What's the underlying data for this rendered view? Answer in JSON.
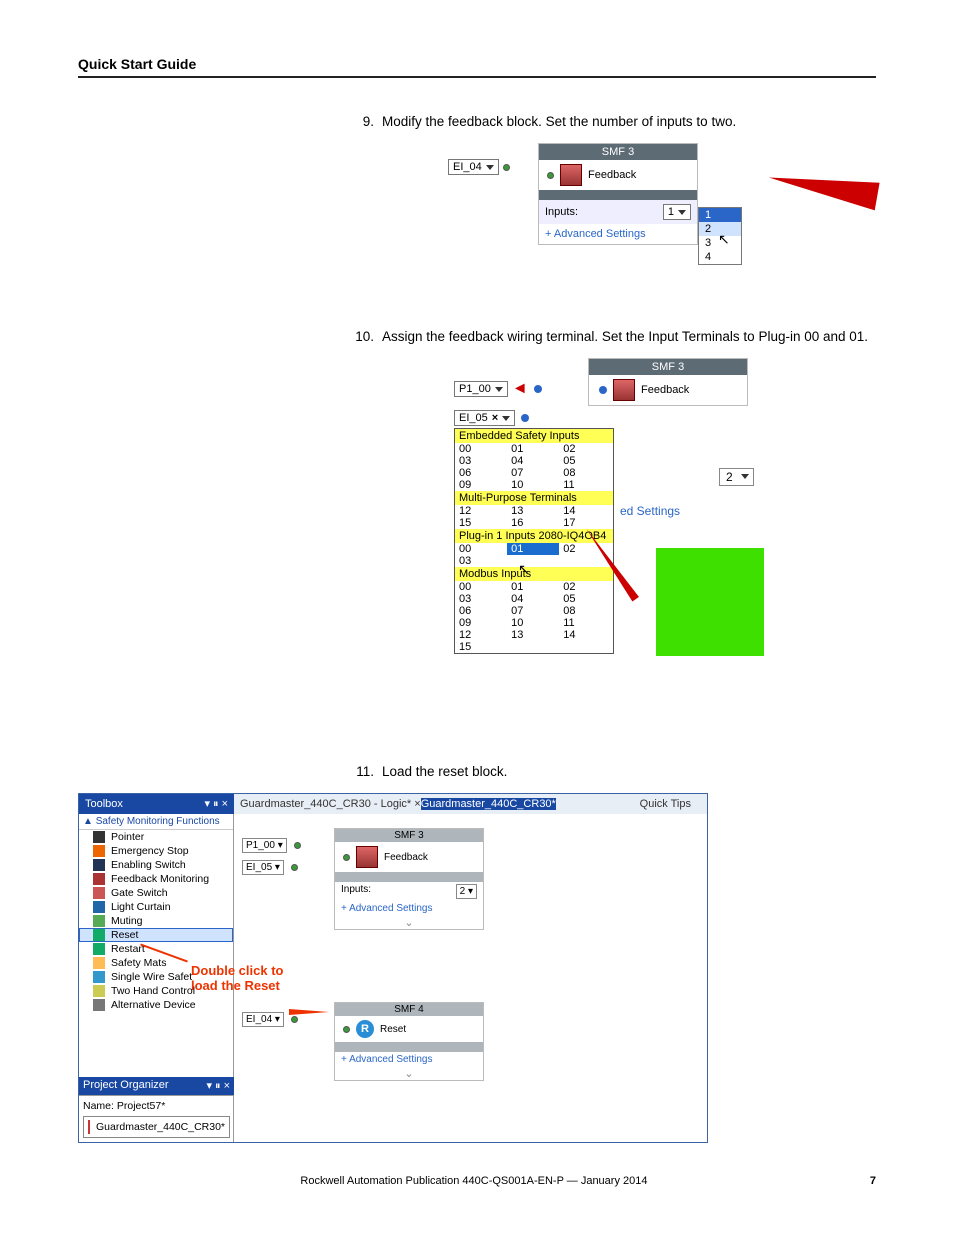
{
  "header": {
    "title": "Quick Start Guide"
  },
  "steps": [
    {
      "num": "9.",
      "text": "Modify the feedback block. Set the number of inputs to two."
    },
    {
      "num": "10.",
      "text": "Assign the feedback wiring terminal. Set the Input Terminals to Plug-in 00 and 01."
    },
    {
      "num": "11.",
      "text": "Load the reset block."
    }
  ],
  "fig1": {
    "selector": "EI_04",
    "card_title": "SMF 3",
    "card_label": "Feedback",
    "inputs_label": "Inputs:",
    "inputs_value": "1",
    "adv": "+ Advanced Settings",
    "dropdown": [
      "1",
      "2",
      "3",
      "4"
    ]
  },
  "fig2": {
    "card_title": "SMF 3",
    "card_label": "Feedback",
    "sel_top": "P1_00",
    "sel_bot": "EI_05",
    "menu": {
      "h1": "Embedded Safety Inputs",
      "rows1": [
        [
          "00",
          "01",
          "02"
        ],
        [
          "03",
          "04",
          "05"
        ],
        [
          "06",
          "07",
          "08"
        ],
        [
          "09",
          "10",
          "11"
        ]
      ],
      "h2": "Multi-Purpose Terminals",
      "rows2": [
        [
          "12",
          "13",
          "14"
        ],
        [
          "15",
          "16",
          "17"
        ]
      ],
      "h3": "Plug-in 1 Inputs 2080-IQ4OB4",
      "rows3": [
        [
          "00",
          "01",
          "02"
        ],
        [
          "03",
          "",
          ""
        ]
      ],
      "h4": "Modbus Inputs",
      "rows4": [
        [
          "00",
          "01",
          "02"
        ],
        [
          "03",
          "04",
          "05"
        ],
        [
          "06",
          "07",
          "08"
        ],
        [
          "09",
          "10",
          "11"
        ],
        [
          "12",
          "13",
          "14"
        ],
        [
          "15",
          "",
          ""
        ]
      ]
    },
    "right_label": "ed Settings",
    "num_box": "2"
  },
  "fig3": {
    "toolbox_title": "Toolbox",
    "toolbox_pins": "▾ ⏸ ×",
    "toolbox_subtitle": "Safety Monitoring Functions",
    "items": [
      {
        "label": "Pointer",
        "ic": "#333"
      },
      {
        "label": "Emergency Stop",
        "ic": "#e60"
      },
      {
        "label": "Enabling Switch",
        "ic": "#235"
      },
      {
        "label": "Feedback Monitoring",
        "ic": "#a33"
      },
      {
        "label": "Gate Switch",
        "ic": "#c55"
      },
      {
        "label": "Light Curtain",
        "ic": "#26a"
      },
      {
        "label": "Muting",
        "ic": "#5a5"
      },
      {
        "label": "Reset",
        "ic": "#1a6",
        "sel": true
      },
      {
        "label": "Restart",
        "ic": "#1a6"
      },
      {
        "label": "Safety Mats",
        "ic": "#fb5"
      },
      {
        "label": "Single Wire Safet",
        "ic": "#39c"
      },
      {
        "label": "Two Hand Control",
        "ic": "#cc5"
      },
      {
        "label": "Alternative Device",
        "ic": "#777"
      }
    ],
    "tabs": {
      "active": "Guardmaster_440C_CR30 - Logic*",
      "close": "×",
      "inactive": "Guardmaster_440C_CR30*",
      "right": "Quick Tips"
    },
    "proj": {
      "title": "Project Organizer",
      "pins": "▾ ⏸ ×",
      "name_label": "Name:",
      "name": "Project57*",
      "item": "Guardmaster_440C_CR30*"
    },
    "canvas": {
      "smf3_title": "SMF 3",
      "smf3_label": "Feedback",
      "smf3_sel1": "P1_00",
      "smf3_sel2": "EI_05",
      "smf3_inputs": "Inputs:",
      "smf3_num": "2",
      "smf3_adv": "+ Advanced Settings",
      "smf4_title": "SMF 4",
      "smf4_label": "Reset",
      "smf4_adv": "+ Advanced Settings",
      "smf4_sel": "EI_04"
    },
    "dbl_click_1": "Double click to",
    "dbl_click_2": "load the Reset"
  },
  "footer": {
    "pub": "Rockwell Automation Publication 440C-QS001A-EN-P — January 2014",
    "page": "7"
  }
}
